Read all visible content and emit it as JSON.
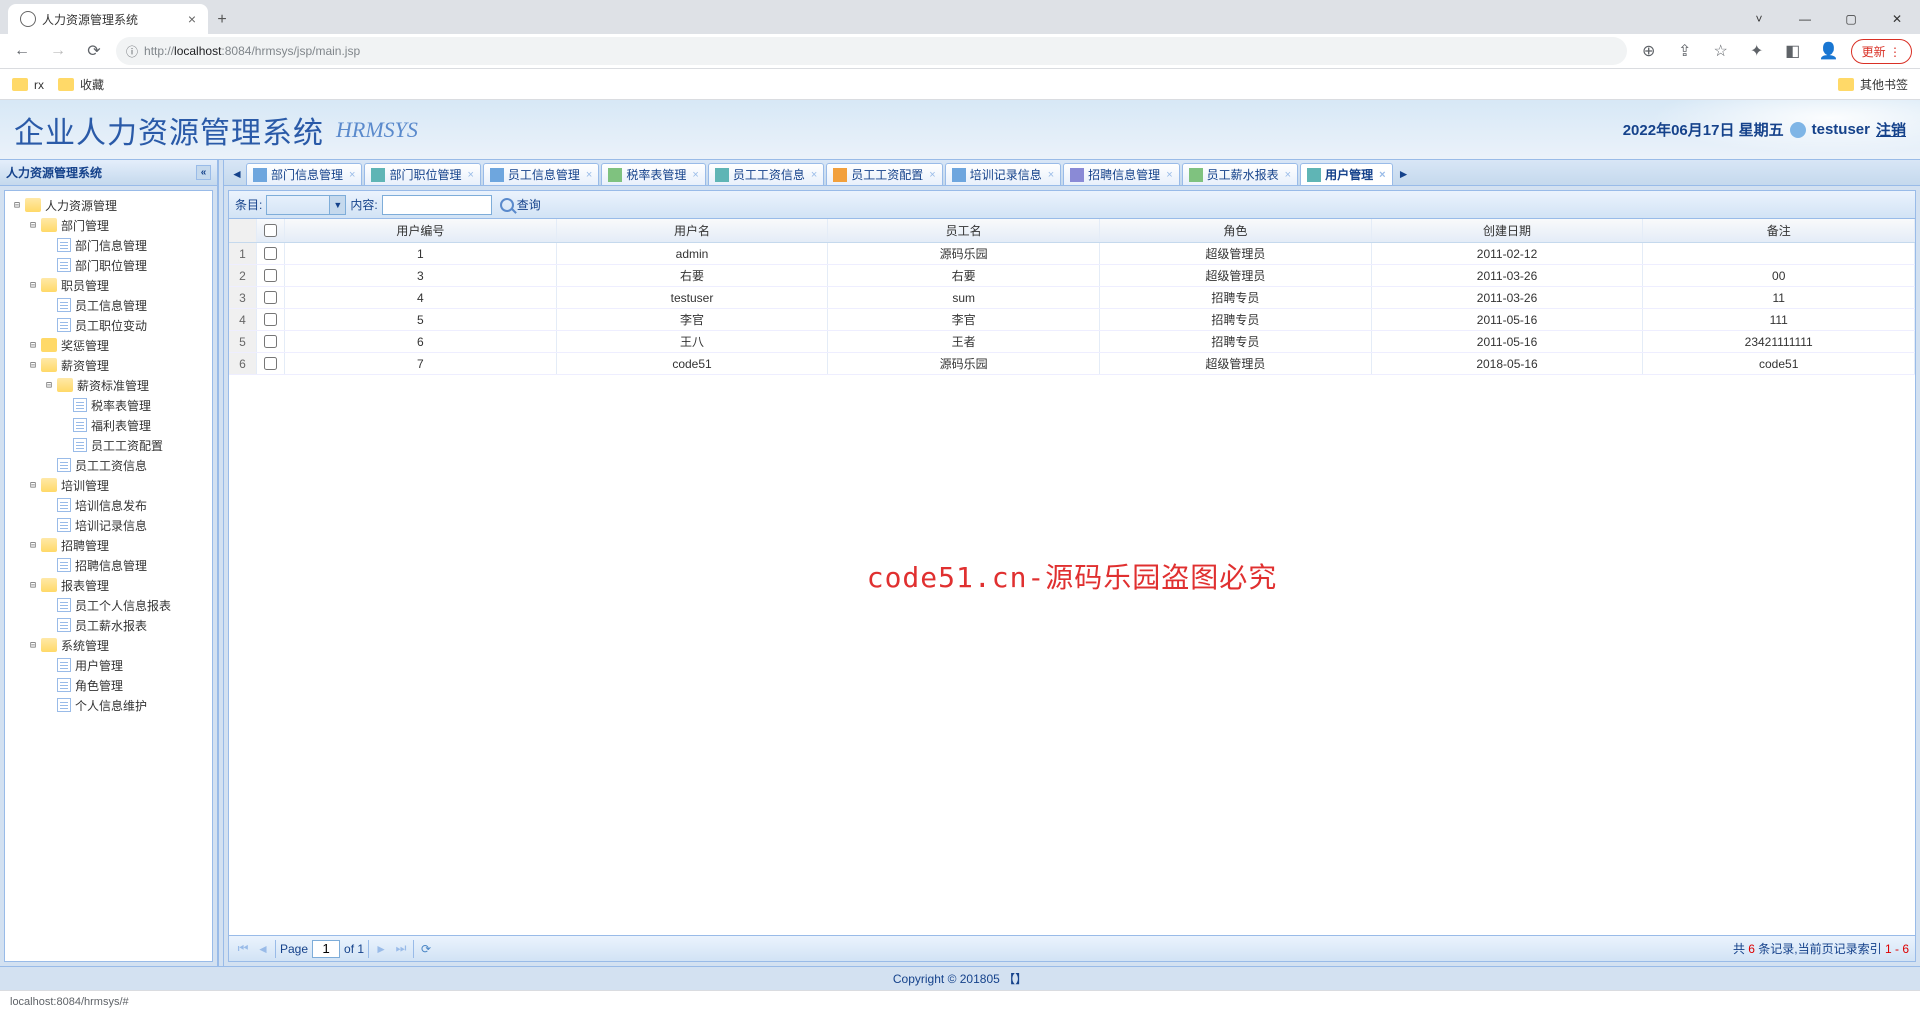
{
  "browser": {
    "tab_title": "人力资源管理系统",
    "url_display_prefix": "http://",
    "url_display_main": "localhost",
    "url_display_suffix": ":8084/hrmsys/jsp/main.jsp",
    "update_label": "更新",
    "bookmarks": [
      "rx",
      "收藏"
    ],
    "other_bookmarks": "其他书签",
    "status_bar": "localhost:8084/hrmsys/#"
  },
  "header": {
    "title_cn": "企业人力资源管理系统",
    "title_en": "HRMSYS",
    "date_text": "2022年06月17日 星期五",
    "username": "testuser",
    "logout": "注销"
  },
  "sidebar": {
    "title": "人力资源管理系统",
    "tree": [
      {
        "label": "人力资源管理",
        "level": 0,
        "type": "folder",
        "open": true
      },
      {
        "label": "部门管理",
        "level": 1,
        "type": "folder",
        "open": true
      },
      {
        "label": "部门信息管理",
        "level": 2,
        "type": "leaf"
      },
      {
        "label": "部门职位管理",
        "level": 2,
        "type": "leaf"
      },
      {
        "label": "职员管理",
        "level": 1,
        "type": "folder",
        "open": true
      },
      {
        "label": "员工信息管理",
        "level": 2,
        "type": "leaf"
      },
      {
        "label": "员工职位变动",
        "level": 2,
        "type": "leaf"
      },
      {
        "label": "奖惩管理",
        "level": 1,
        "type": "folder",
        "open": false
      },
      {
        "label": "薪资管理",
        "level": 1,
        "type": "folder",
        "open": true
      },
      {
        "label": "薪资标准管理",
        "level": 2,
        "type": "folder",
        "open": true
      },
      {
        "label": "税率表管理",
        "level": 3,
        "type": "leaf"
      },
      {
        "label": "福利表管理",
        "level": 3,
        "type": "leaf"
      },
      {
        "label": "员工工资配置",
        "level": 3,
        "type": "leaf"
      },
      {
        "label": "员工工资信息",
        "level": 2,
        "type": "leaf"
      },
      {
        "label": "培训管理",
        "level": 1,
        "type": "folder",
        "open": true
      },
      {
        "label": "培训信息发布",
        "level": 2,
        "type": "leaf"
      },
      {
        "label": "培训记录信息",
        "level": 2,
        "type": "leaf"
      },
      {
        "label": "招聘管理",
        "level": 1,
        "type": "folder",
        "open": true
      },
      {
        "label": "招聘信息管理",
        "level": 2,
        "type": "leaf"
      },
      {
        "label": "报表管理",
        "level": 1,
        "type": "folder",
        "open": true
      },
      {
        "label": "员工个人信息报表",
        "level": 2,
        "type": "leaf"
      },
      {
        "label": "员工薪水报表",
        "level": 2,
        "type": "leaf"
      },
      {
        "label": "系统管理",
        "level": 1,
        "type": "folder",
        "open": true
      },
      {
        "label": "用户管理",
        "level": 2,
        "type": "leaf"
      },
      {
        "label": "角色管理",
        "level": 2,
        "type": "leaf"
      },
      {
        "label": "个人信息维护",
        "level": 2,
        "type": "leaf"
      }
    ]
  },
  "tabs": [
    {
      "label": "部门信息管理",
      "ico": "blue"
    },
    {
      "label": "部门职位管理",
      "ico": "teal"
    },
    {
      "label": "员工信息管理",
      "ico": "blue"
    },
    {
      "label": "税率表管理",
      "ico": "green"
    },
    {
      "label": "员工工资信息",
      "ico": "teal"
    },
    {
      "label": "员工工资配置",
      "ico": "orange"
    },
    {
      "label": "培训记录信息",
      "ico": "blue"
    },
    {
      "label": "招聘信息管理",
      "ico": "purple"
    },
    {
      "label": "员工薪水报表",
      "ico": "green"
    },
    {
      "label": "用户管理",
      "ico": "teal",
      "active": true
    }
  ],
  "toolbar": {
    "label_field": "条目:",
    "label_content": "内容:",
    "search": "查询"
  },
  "grid": {
    "headers": [
      "用户编号",
      "用户名",
      "员工名",
      "角色",
      "创建日期",
      "备注"
    ],
    "rows": [
      {
        "n": "1",
        "id": "1",
        "user": "admin",
        "emp": "源码乐园",
        "role": "超级管理员",
        "date": "2011-02-12",
        "remark": ""
      },
      {
        "n": "2",
        "id": "3",
        "user": "右要",
        "emp": "右要",
        "role": "超级管理员",
        "date": "2011-03-26",
        "remark": "00"
      },
      {
        "n": "3",
        "id": "4",
        "user": "testuser",
        "emp": "sum",
        "role": "招聘专员",
        "date": "2011-03-26",
        "remark": "11"
      },
      {
        "n": "4",
        "id": "5",
        "user": "李官",
        "emp": "李官",
        "role": "招聘专员",
        "date": "2011-05-16",
        "remark": "111"
      },
      {
        "n": "5",
        "id": "6",
        "user": "王八",
        "emp": "王者",
        "role": "招聘专员",
        "date": "2011-05-16",
        "remark": "23421111111"
      },
      {
        "n": "6",
        "id": "7",
        "user": "code51",
        "emp": "源码乐园",
        "role": "超级管理员",
        "date": "2018-05-16",
        "remark": "code51"
      }
    ]
  },
  "paging": {
    "page_label": "Page",
    "page_current": "1",
    "of_label": "of 1",
    "summary_prefix": "共 ",
    "summary_count": "6",
    "summary_mid": " 条记录,当前页记录索引 ",
    "summary_range": "1 - 6"
  },
  "watermark": "code51.cn-源码乐园盗图必究",
  "footer": "Copyright © 201805 【】"
}
